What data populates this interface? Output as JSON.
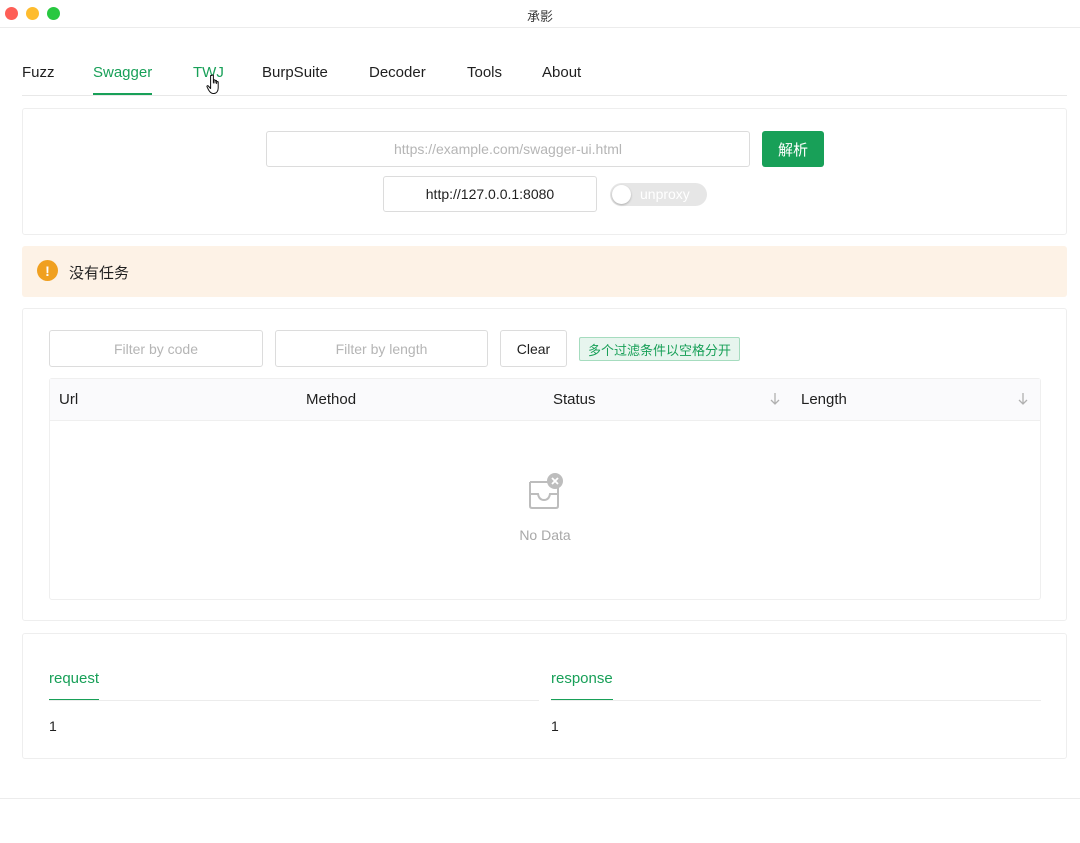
{
  "window": {
    "title": "承影"
  },
  "tabs": [
    {
      "label": "Fuzz"
    },
    {
      "label": "Swagger"
    },
    {
      "label": "TWJ"
    },
    {
      "label": "BurpSuite"
    },
    {
      "label": "Decoder"
    },
    {
      "label": "Tools"
    },
    {
      "label": "About"
    }
  ],
  "active_tab": "Swagger",
  "swagger": {
    "url_placeholder": "https://example.com/swagger-ui.html",
    "parse_button": "解析",
    "proxy_value": "http://127.0.0.1:8080",
    "proxy_switch_label": "unproxy",
    "proxy_switch_on": false
  },
  "alert": {
    "text": "没有任务",
    "icon": "exclamation-icon",
    "color": "#f0a020"
  },
  "filters": {
    "code_placeholder": "Filter by code",
    "length_placeholder": "Filter by length",
    "clear_button": "Clear",
    "hint_tag": "多个过滤条件以空格分开"
  },
  "table": {
    "columns": [
      "Url",
      "Method",
      "Status",
      "Length"
    ],
    "rows": [],
    "empty_text": "No Data"
  },
  "detail": {
    "request_label": "request",
    "request_value": "1",
    "response_label": "response",
    "response_value": "1"
  },
  "colors": {
    "accent": "#18a058",
    "alert_bg": "#fdf2e6",
    "warning": "#f0a020"
  }
}
